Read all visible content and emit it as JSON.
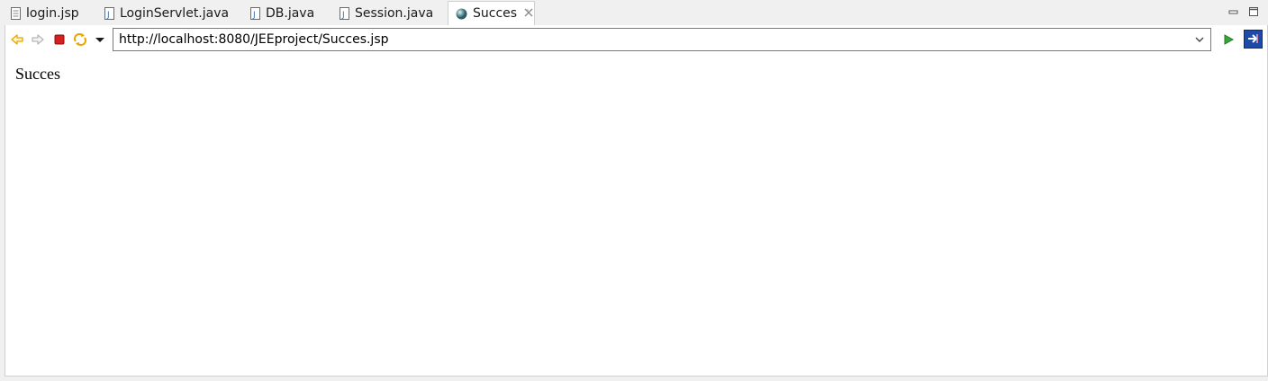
{
  "tabs": [
    {
      "label": "login.jsp",
      "icon": "jsp-file-icon"
    },
    {
      "label": "LoginServlet.java",
      "icon": "java-file-icon"
    },
    {
      "label": "DB.java",
      "icon": "java-file-icon"
    },
    {
      "label": "Session.java",
      "icon": "java-file-icon"
    },
    {
      "label": "Succes",
      "icon": "globe-icon",
      "active": true
    }
  ],
  "toolbar": {
    "url": "http://localhost:8080/JEEproject/Succes.jsp"
  },
  "page": {
    "text": "Succes"
  },
  "colors": {
    "back_arrow": "#e8a500",
    "stop": "#d42020",
    "go": "#3aa63a",
    "ide_icon": "#1e4aa8"
  }
}
